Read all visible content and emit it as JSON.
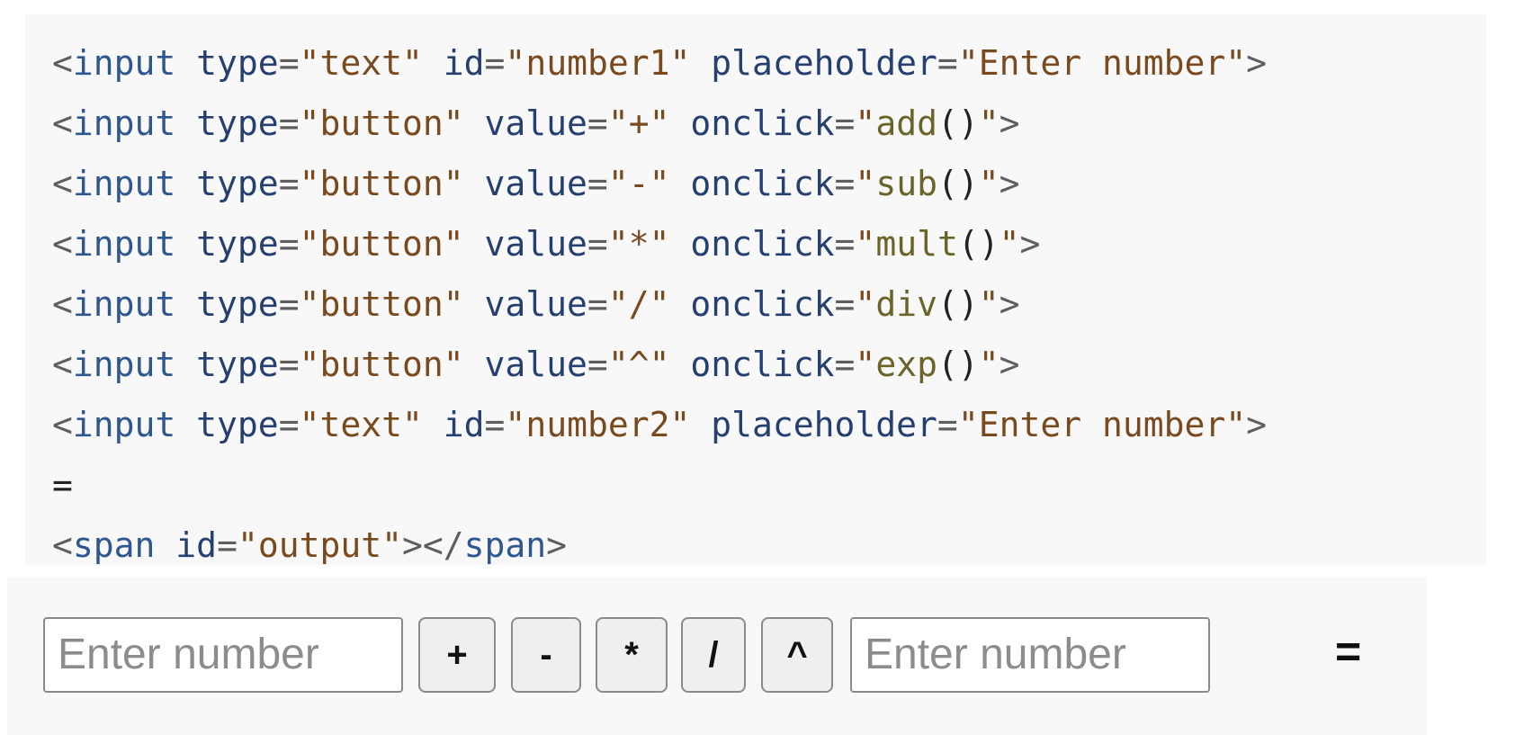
{
  "code": {
    "tag_input": "input",
    "tag_span": "span",
    "attr_type": "type",
    "attr_id": "id",
    "attr_placeholder": "placeholder",
    "attr_value": "value",
    "attr_onclick": "onclick",
    "lines": [
      {
        "type": "text",
        "id": "number1",
        "placeholder": "Enter number"
      },
      {
        "type": "button",
        "value": "+",
        "fn": "add"
      },
      {
        "type": "button",
        "value": "-",
        "fn": "sub"
      },
      {
        "type": "button",
        "value": "*",
        "fn": "mult"
      },
      {
        "type": "button",
        "value": "/",
        "fn": "div"
      },
      {
        "type": "button",
        "value": "^",
        "fn": "exp"
      },
      {
        "type": "text",
        "id": "number2",
        "placeholder": "Enter number"
      },
      {
        "plain": "="
      },
      {
        "span_id": "output"
      }
    ]
  },
  "preview": {
    "input1": {
      "placeholder": "Enter number",
      "value": ""
    },
    "buttons": [
      {
        "label": "+"
      },
      {
        "label": "-"
      },
      {
        "label": "*"
      },
      {
        "label": "/"
      },
      {
        "label": "^"
      }
    ],
    "input2": {
      "placeholder": "Enter number",
      "value": ""
    },
    "equals": "=",
    "output": ""
  }
}
